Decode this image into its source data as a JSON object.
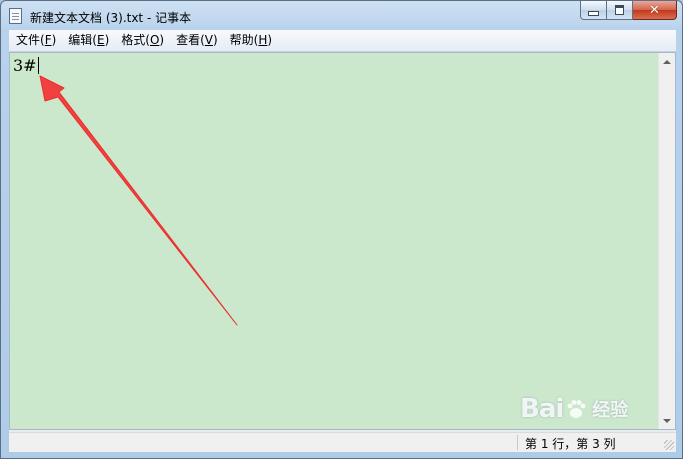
{
  "window": {
    "title": "新建文本文档 (3).txt - 记事本",
    "controls": {
      "minimize": "minimize",
      "maximize": "maximize",
      "close": "✕"
    }
  },
  "menu": {
    "items": [
      {
        "label": "文件(",
        "key": "F",
        "close": ")"
      },
      {
        "label": "编辑(",
        "key": "E",
        "close": ")"
      },
      {
        "label": "格式(",
        "key": "O",
        "close": ")"
      },
      {
        "label": "查看(",
        "key": "V",
        "close": ")"
      },
      {
        "label": "帮助(",
        "key": "H",
        "close": ")"
      }
    ]
  },
  "editor": {
    "content": "3#",
    "background": "#cce8cc"
  },
  "status": {
    "position": "第 1 行，第 3 列"
  },
  "annotation": {
    "color": "#f04040",
    "icon": "red-arrow"
  },
  "watermark": {
    "brand": "Bai",
    "suffix": "经验",
    "icon": "baidu-paw-icon"
  }
}
